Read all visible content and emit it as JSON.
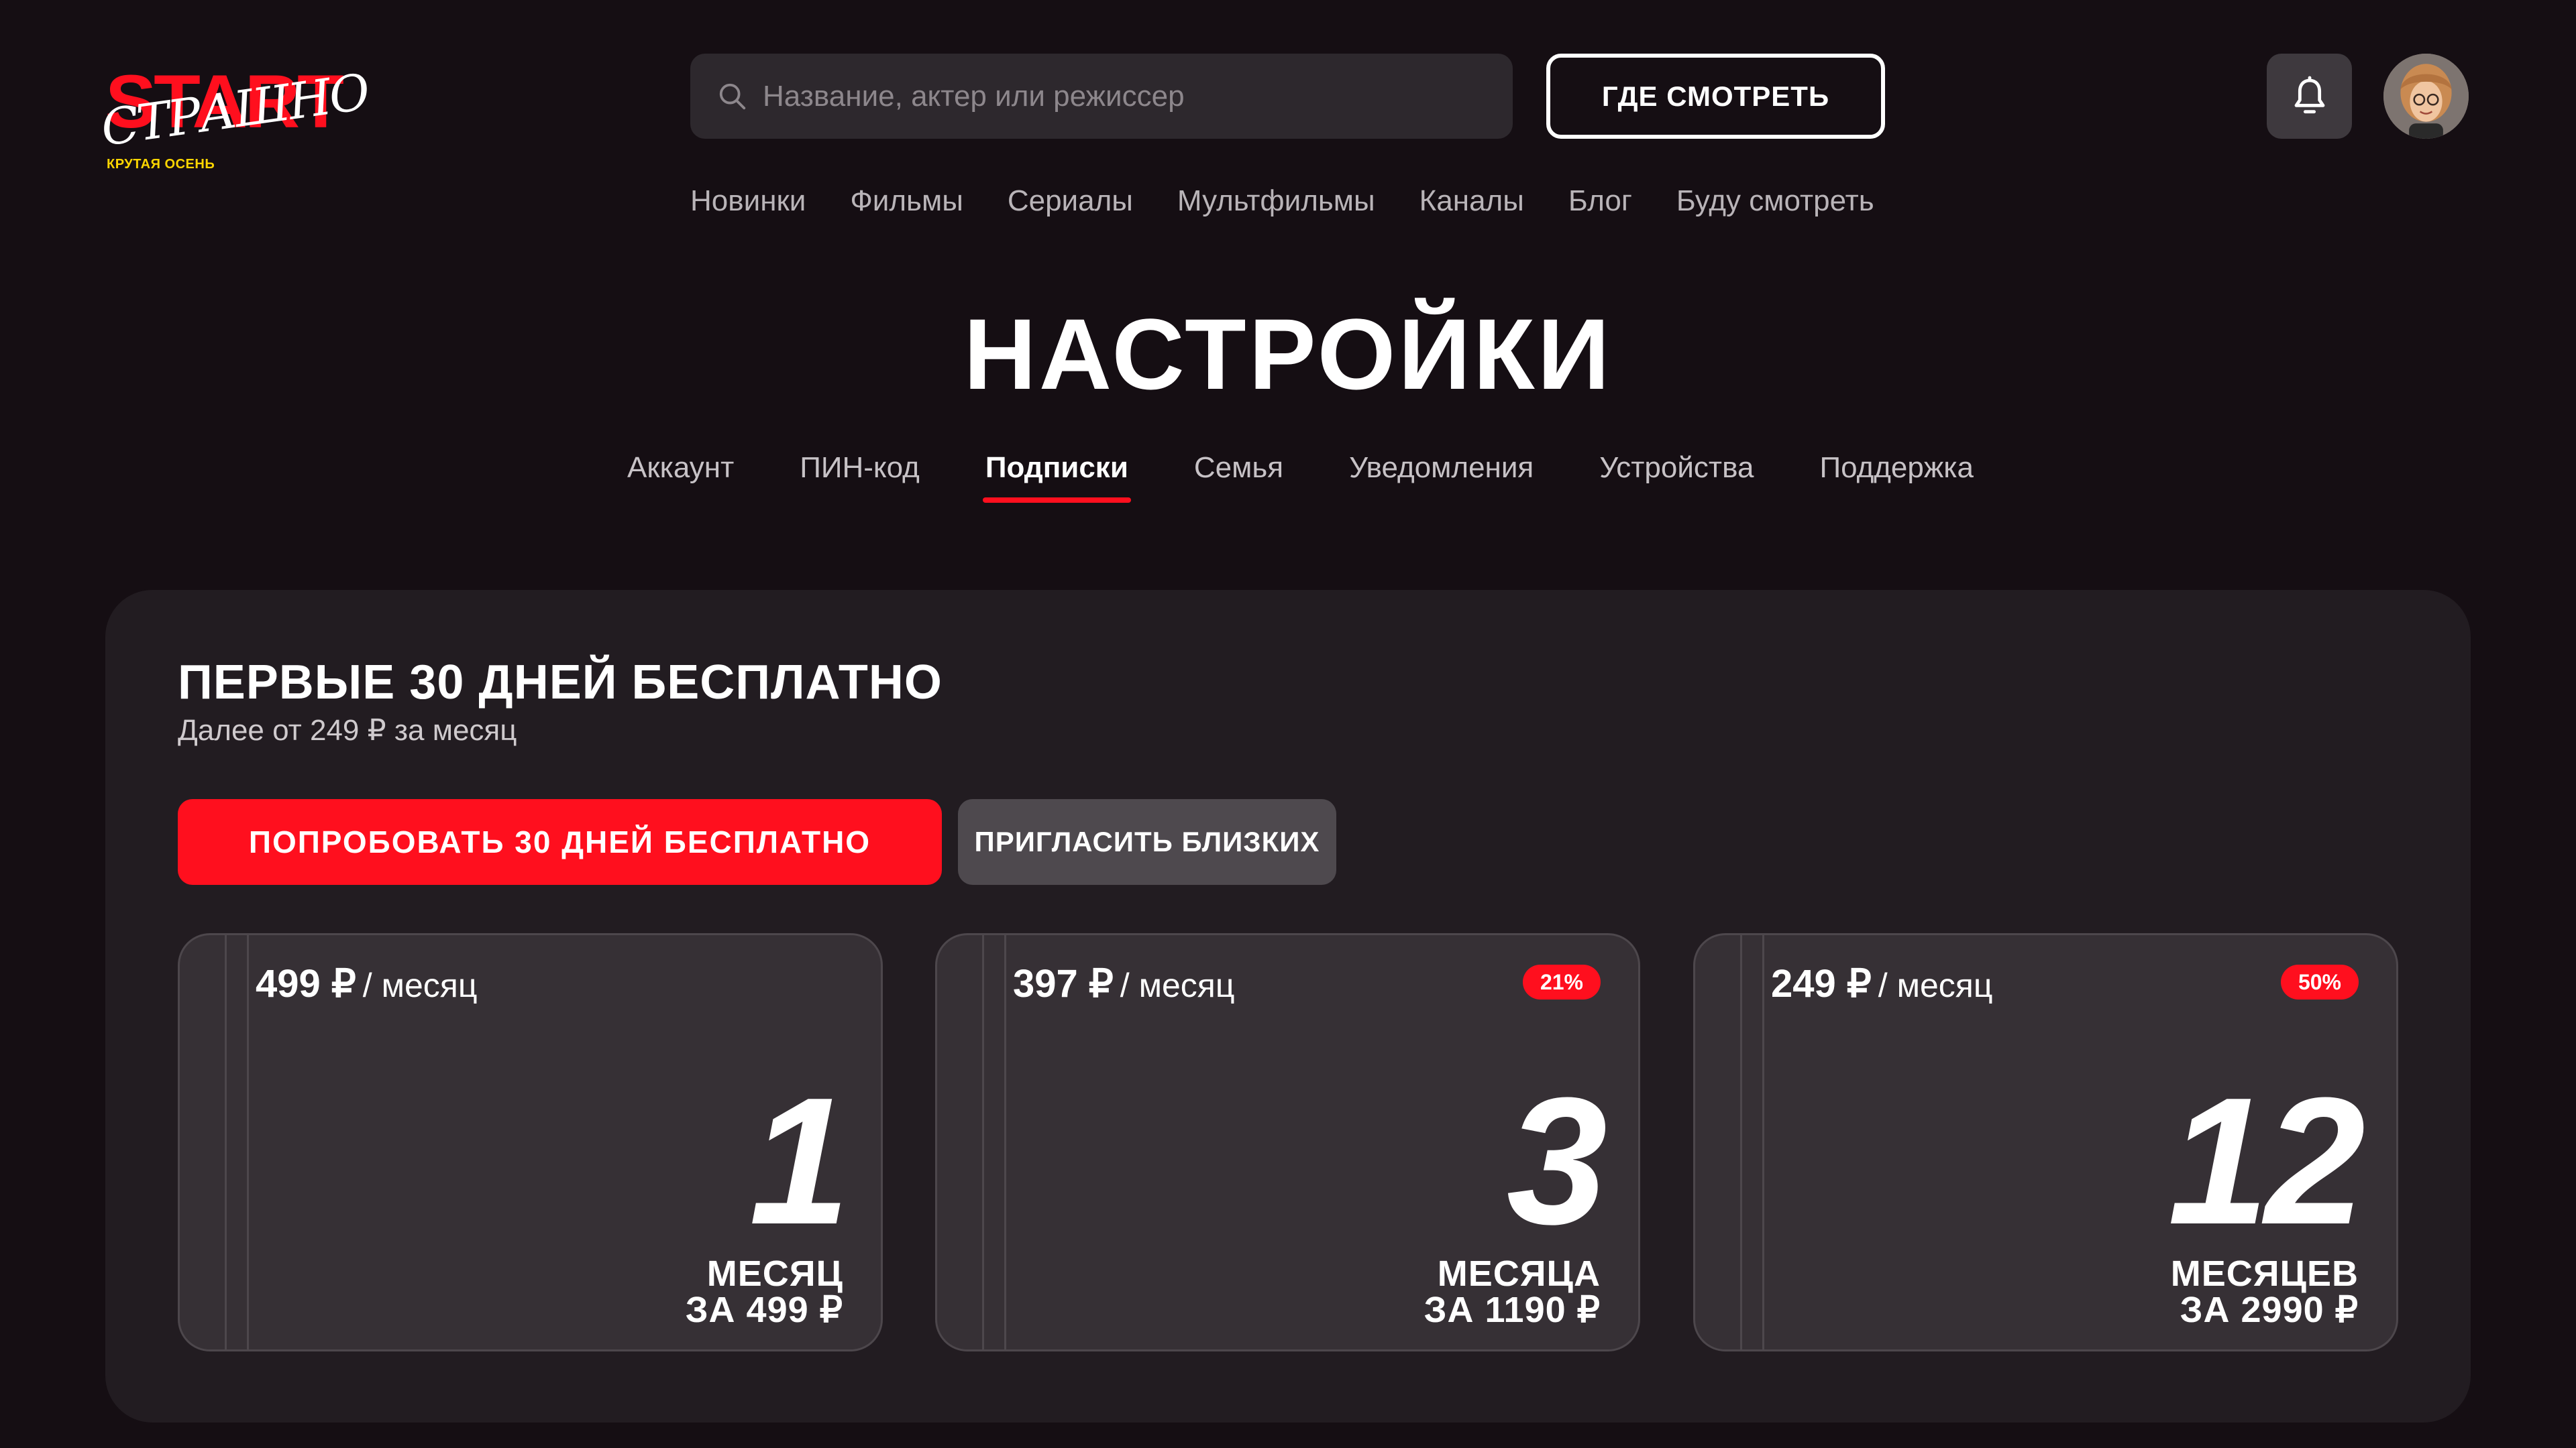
{
  "logo": {
    "brand": "START",
    "script": "СТРАШНО",
    "tagline": "КРУТАЯ ОСЕНЬ"
  },
  "header": {
    "search_placeholder": "Название, актер или режиссер",
    "where_to_watch": "ГДЕ СМОТРЕТЬ",
    "icons": {
      "search": "search-icon",
      "notifications": "bell-icon",
      "avatar": "user-avatar"
    }
  },
  "topnav": {
    "items": [
      {
        "label": "Новинки"
      },
      {
        "label": "Фильмы"
      },
      {
        "label": "Сериалы"
      },
      {
        "label": "Мультфильмы"
      },
      {
        "label": "Каналы"
      },
      {
        "label": "Блог"
      },
      {
        "label": "Буду смотреть"
      }
    ]
  },
  "page": {
    "title": "НАСТРОЙКИ"
  },
  "tabs": {
    "active": "Подписки",
    "items": [
      {
        "label": "Аккаунт"
      },
      {
        "label": "ПИН-код"
      },
      {
        "label": "Подписки"
      },
      {
        "label": "Семья"
      },
      {
        "label": "Уведомления"
      },
      {
        "label": "Устройства"
      },
      {
        "label": "Поддержка"
      }
    ]
  },
  "promo": {
    "title": "ПЕРВЫЕ 30 ДНЕЙ БЕСПЛАТНО",
    "subtitle": "Далее от 249 ₽ за месяц",
    "try_button": "ПОПРОБОВАТЬ 30 ДНЕЙ БЕСПЛАТНО",
    "invite_button": "ПРИГЛАСИТЬ БЛИЗКИХ"
  },
  "plans": [
    {
      "price": "499 ₽",
      "per": "/ месяц",
      "badge": "",
      "number": "1",
      "unit": "МЕСЯЦ",
      "total": "ЗА 499 ₽"
    },
    {
      "price": "397 ₽",
      "per": "/ месяц",
      "badge": "21%",
      "number": "3",
      "unit": "МЕСЯЦА",
      "total": "ЗА 1190 ₽"
    },
    {
      "price": "249 ₽",
      "per": "/ месяц",
      "badge": "50%",
      "number": "12",
      "unit": "МЕСЯЦЕВ",
      "total": "ЗА 2990 ₽"
    }
  ],
  "colors": {
    "background": "#150e13",
    "accent": "#ff0f1e",
    "panel": "#221c21",
    "card": "#363035",
    "logo_tag": "#ffd600"
  }
}
